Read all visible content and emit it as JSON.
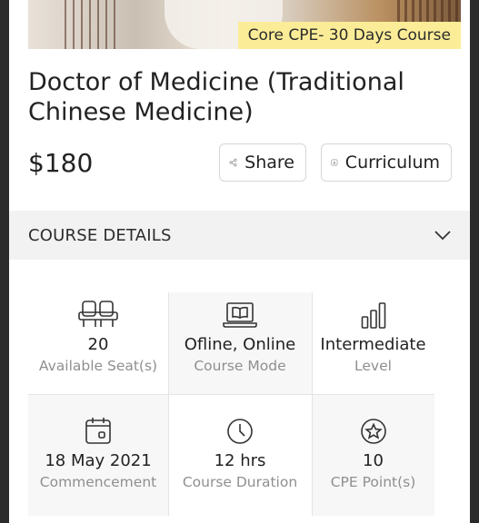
{
  "hero": {
    "tag": "Core CPE- 30 Days Course"
  },
  "course": {
    "title": "Doctor of Medicine (Traditional Chinese Medicine)",
    "price": "$180"
  },
  "actions": {
    "share_label": "Share",
    "curriculum_label": "Curriculum"
  },
  "details": {
    "section_label": "COURSE DETAILS",
    "items": [
      {
        "icon": "seats-icon",
        "value": "20",
        "label": "Available Seat(s)"
      },
      {
        "icon": "laptop-book-icon",
        "value": "Ofline, Online",
        "label": "Course Mode"
      },
      {
        "icon": "level-bars-icon",
        "value": "Intermediate",
        "label": "Level"
      },
      {
        "icon": "calendar-icon",
        "value": "18 May 2021",
        "label": "Commencement"
      },
      {
        "icon": "clock-icon",
        "value": "12 hrs",
        "label": "Course Duration"
      },
      {
        "icon": "star-badge-icon",
        "value": "10",
        "label": "CPE Point(s)"
      }
    ]
  },
  "colors": {
    "tag_bg": "#fbec97",
    "section_bg": "#f2f2f2",
    "muted_text": "#8f8f8f"
  }
}
